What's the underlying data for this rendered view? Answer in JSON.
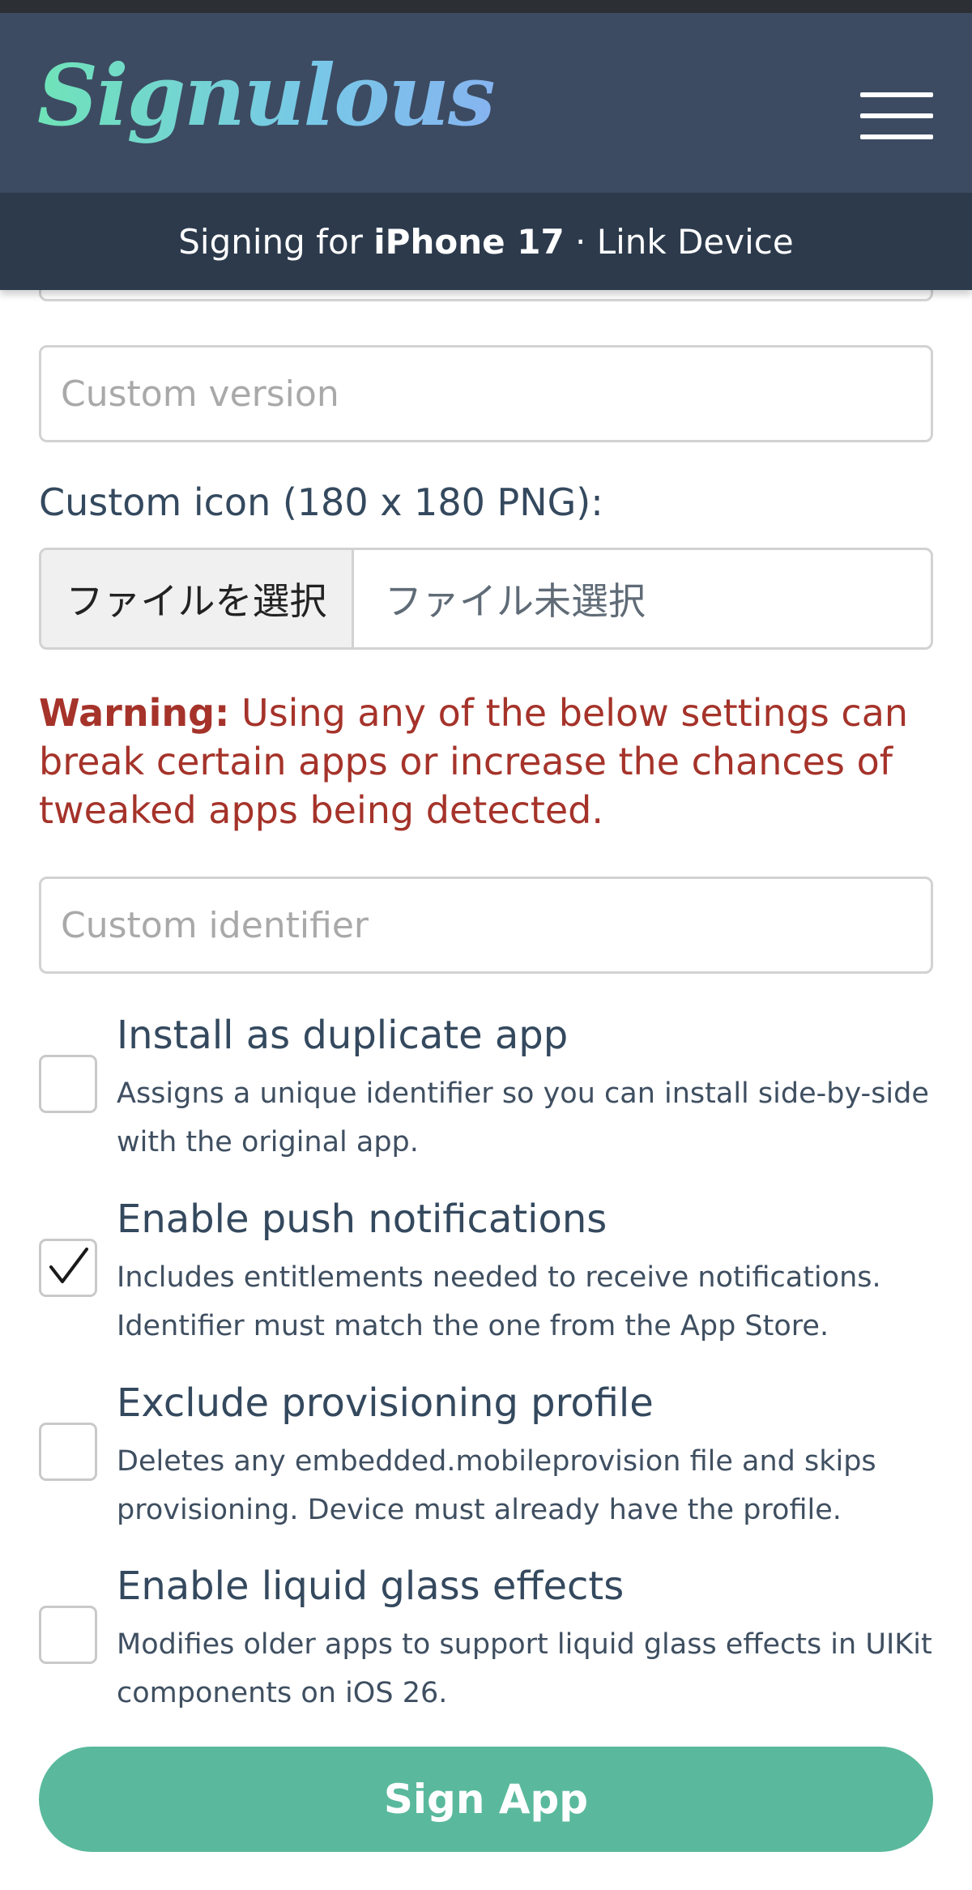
{
  "header": {
    "logo_text": "Signulous",
    "menu_icon": "hamburger-menu-icon",
    "logo_gradient": [
      "#6fe3b8",
      "#86b4f0"
    ],
    "navbar_color": "#3c4b62"
  },
  "subbar": {
    "prefix": "Signing for ",
    "device": "iPhone 17",
    "separator": " · ",
    "link": "Link Device"
  },
  "form": {
    "custom_version": {
      "value": "",
      "placeholder": "Custom version"
    },
    "custom_icon_label": "Custom icon (180 x 180 PNG):",
    "file_button": "ファイルを選択",
    "file_status": "ファイル未選択",
    "warning_strong": "Warning:",
    "warning_text": " Using any of the below settings can break certain apps or increase the chances of tweaked apps being detected.",
    "custom_identifier": {
      "value": "",
      "placeholder": "Custom identifier"
    },
    "options": [
      {
        "title": "Install as duplicate app",
        "description": "Assigns a unique identifier so you can install side-by-side with the original app.",
        "checked": false
      },
      {
        "title": "Enable push notifications",
        "description": "Includes entitlements needed to receive notifications. Identifier must match the one from the App Store.",
        "checked": true
      },
      {
        "title": "Exclude provisioning profile",
        "description": "Deletes any embedded.mobileprovision file and skips provisioning. Device must already have the profile.",
        "checked": false
      },
      {
        "title": "Enable liquid glass effects",
        "description": "Modifies older apps to support liquid glass effects in UIKit components on iOS 26.",
        "checked": false
      }
    ],
    "sign_button": "Sign App"
  },
  "colors": {
    "warning": "#a5332a",
    "primary_button": "#5ab99c",
    "subbar": "#2c3a4c"
  }
}
